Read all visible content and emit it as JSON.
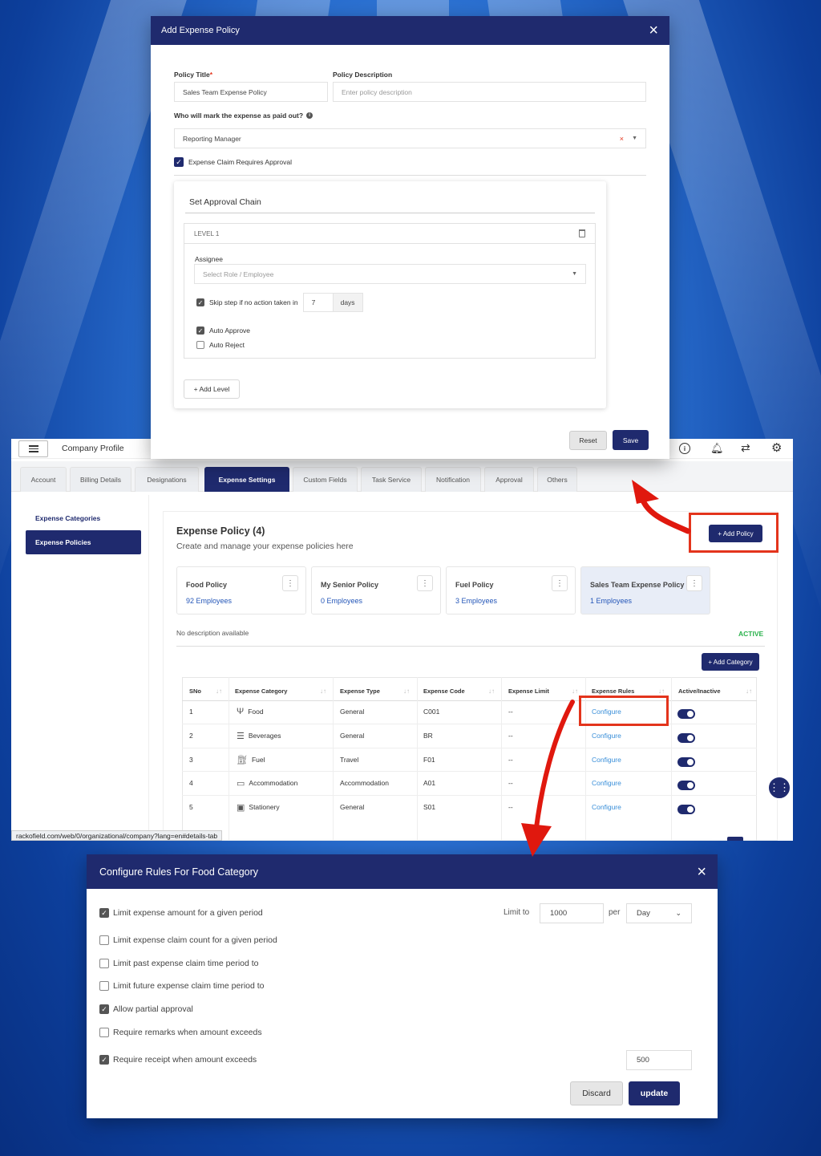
{
  "add_policy_modal": {
    "title": "Add Expense Policy",
    "policy_title_label": "Policy Title",
    "required_mark": "*",
    "policy_title_value": "Sales Team Expense Policy",
    "policy_description_label": "Policy Description",
    "policy_description_placeholder": "Enter policy description",
    "paid_out_label": "Who will mark the expense as paid out?",
    "paid_out_value": "Reporting Manager",
    "requires_approval_label": "Expense Claim Requires Approval",
    "approval_chain_title": "Set Approval Chain",
    "level_label": "LEVEL 1",
    "assignee_label": "Assignee",
    "assignee_placeholder": "Select Role / Employee",
    "skip_step_label": "Skip step if no action taken in",
    "skip_days_value": "7",
    "days_label": "days",
    "auto_approve_label": "Auto Approve",
    "auto_reject_label": "Auto Reject",
    "add_level_label": "+ Add Level",
    "reset_label": "Reset",
    "save_label": "Save"
  },
  "app": {
    "header_title": "Company Profile",
    "tabs": [
      "Account",
      "Billing Details",
      "Designations",
      "Expense Settings",
      "Custom Fields",
      "Task Service",
      "Notification",
      "Approval",
      "Others"
    ],
    "sidebar": [
      "Expense Categories",
      "Expense Policies"
    ],
    "policy_heading": "Expense Policy (4)",
    "policy_subheading": "Create and manage your expense policies here",
    "add_policy_label": "+ Add Policy",
    "cards": [
      {
        "title": "Food Policy",
        "employees": "92 Employees"
      },
      {
        "title": "My Senior Policy",
        "employees": "0 Employees"
      },
      {
        "title": "Fuel Policy",
        "employees": "3 Employees"
      },
      {
        "title": "Sales Team Expense Policy",
        "employees": "1 Employees"
      }
    ],
    "no_description": "No description available",
    "status": "ACTIVE",
    "add_category_label": "+ Add Category",
    "table_headers": [
      "SNo",
      "Expense Category",
      "Expense Type",
      "Expense Code",
      "Expense Limit",
      "Expense Rules",
      "Active/Inactive"
    ],
    "rows": [
      {
        "sno": "1",
        "category": "Food",
        "type": "General",
        "code": "C001",
        "limit": "--",
        "rules": "Configure"
      },
      {
        "sno": "2",
        "category": "Beverages",
        "type": "General",
        "code": "BR",
        "limit": "--",
        "rules": "Configure"
      },
      {
        "sno": "3",
        "category": "Fuel",
        "type": "Travel",
        "code": "F01",
        "limit": "--",
        "rules": "Configure"
      },
      {
        "sno": "4",
        "category": "Accommodation",
        "type": "Accommodation",
        "code": "A01",
        "limit": "--",
        "rules": "Configure"
      },
      {
        "sno": "5",
        "category": "Stationery",
        "type": "General",
        "code": "S01",
        "limit": "--",
        "rules": "Configure"
      }
    ],
    "status_url": "rackofield.com/web/0/organizational/company?lang=en#details-tab"
  },
  "rules_modal": {
    "title": "Configure Rules For Food Category",
    "rules": [
      {
        "label": "Limit expense amount for a given period",
        "checked": true
      },
      {
        "label": "Limit expense claim count for a given period",
        "checked": false
      },
      {
        "label": "Limit past expense claim time period to",
        "checked": false
      },
      {
        "label": "Limit future expense claim time period to",
        "checked": false
      },
      {
        "label": "Allow partial approval",
        "checked": true
      },
      {
        "label": "Require remarks when amount exceeds",
        "checked": false
      },
      {
        "label": "Require receipt when amount exceeds",
        "checked": true
      }
    ],
    "limit_to_label": "Limit to",
    "limit_value": "1000",
    "per_label": "per",
    "period_value": "Day",
    "receipt_amount_value": "500",
    "discard_label": "Discard",
    "update_label": "update"
  },
  "colors": {
    "primary": "#1f2a6e",
    "highlight_red": "#e3341c",
    "link": "#3a8fd9",
    "active_green": "#2bb24c"
  }
}
